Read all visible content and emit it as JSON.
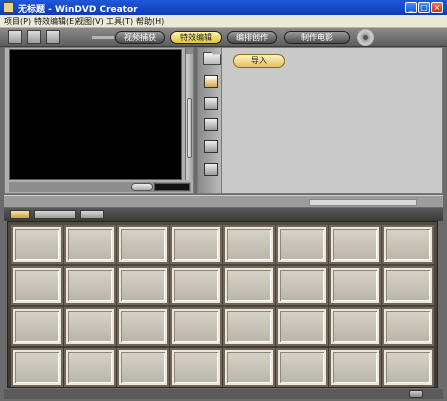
{
  "window": {
    "title": "无标题 - WinDVD Creator",
    "minimize": "_",
    "maximize": "□",
    "close": "×"
  },
  "menu": [
    {
      "label": "项目(P)"
    },
    {
      "label": "特效编辑(E)"
    },
    {
      "label": "视图(V)"
    },
    {
      "label": "工具(T)"
    },
    {
      "label": "帮助(H)"
    }
  ],
  "workflow_steps": [
    {
      "label": "视频捕获",
      "active": false
    },
    {
      "label": "特效编辑",
      "active": true
    },
    {
      "label": "编排创作",
      "active": false
    },
    {
      "label": "制作电影",
      "active": false
    }
  ],
  "library": {
    "import_label": "导入"
  },
  "storyboard": {
    "rows": 4,
    "columns": 8
  },
  "icons": {
    "new": "new-project-icon",
    "print": "print-icon",
    "save": "save-icon",
    "disc": "disc-icon",
    "folder": "folder-icon",
    "film": "film-icon",
    "transition": "transition-icon",
    "shape": "shape-icon",
    "texture": "texture-icon",
    "title": "title-icon"
  },
  "colors": {
    "accent": "#e4c43a",
    "titlebar": "#1f58d8"
  }
}
